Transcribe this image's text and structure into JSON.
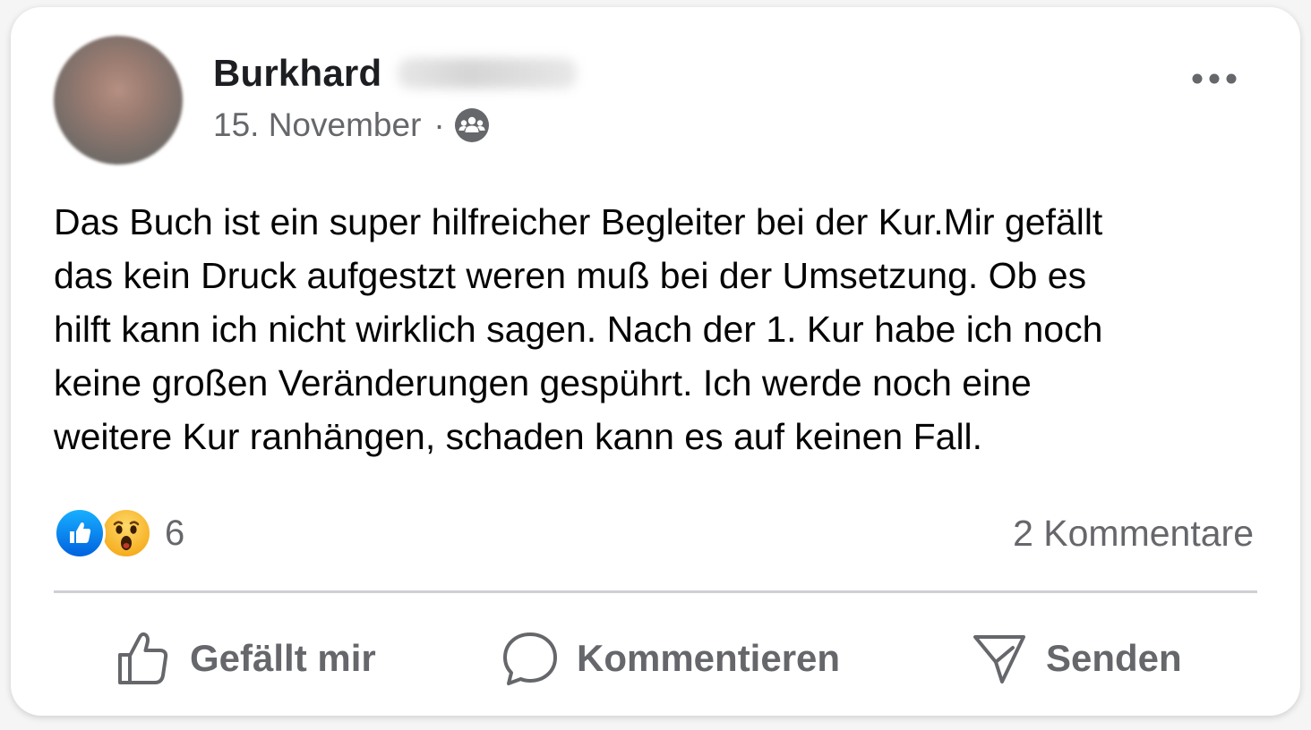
{
  "post": {
    "author_first_name": "Burkhard",
    "date": "15. November",
    "separator": "·",
    "audience_icon": "group-icon",
    "more_icon": "more-options-icon",
    "text": "Das Buch ist ein super hilfreicher Begleiter bei der Kur.Mir gefällt\ndas kein Druck aufgestzt weren muß bei der Umsetzung. Ob es\nhilft kann ich nicht wirklich sagen. Nach der 1. Kur habe ich noch\nkeine großen Veränderungen gespührt. Ich werde noch eine\nweitere Kur ranhängen, schaden kann es auf keinen Fall."
  },
  "reactions": {
    "icons": [
      "like-reaction-icon",
      "wow-reaction-icon"
    ],
    "count": "6",
    "comments_label": "2 Kommentare"
  },
  "actions": {
    "like_label": "Gefällt mir",
    "comment_label": "Kommentieren",
    "share_label": "Senden"
  },
  "colors": {
    "text_primary": "#050505",
    "text_secondary": "#65676b",
    "like_blue": "#0866ff",
    "wow_yellow": "#f7b125",
    "divider": "#ced0d4"
  }
}
